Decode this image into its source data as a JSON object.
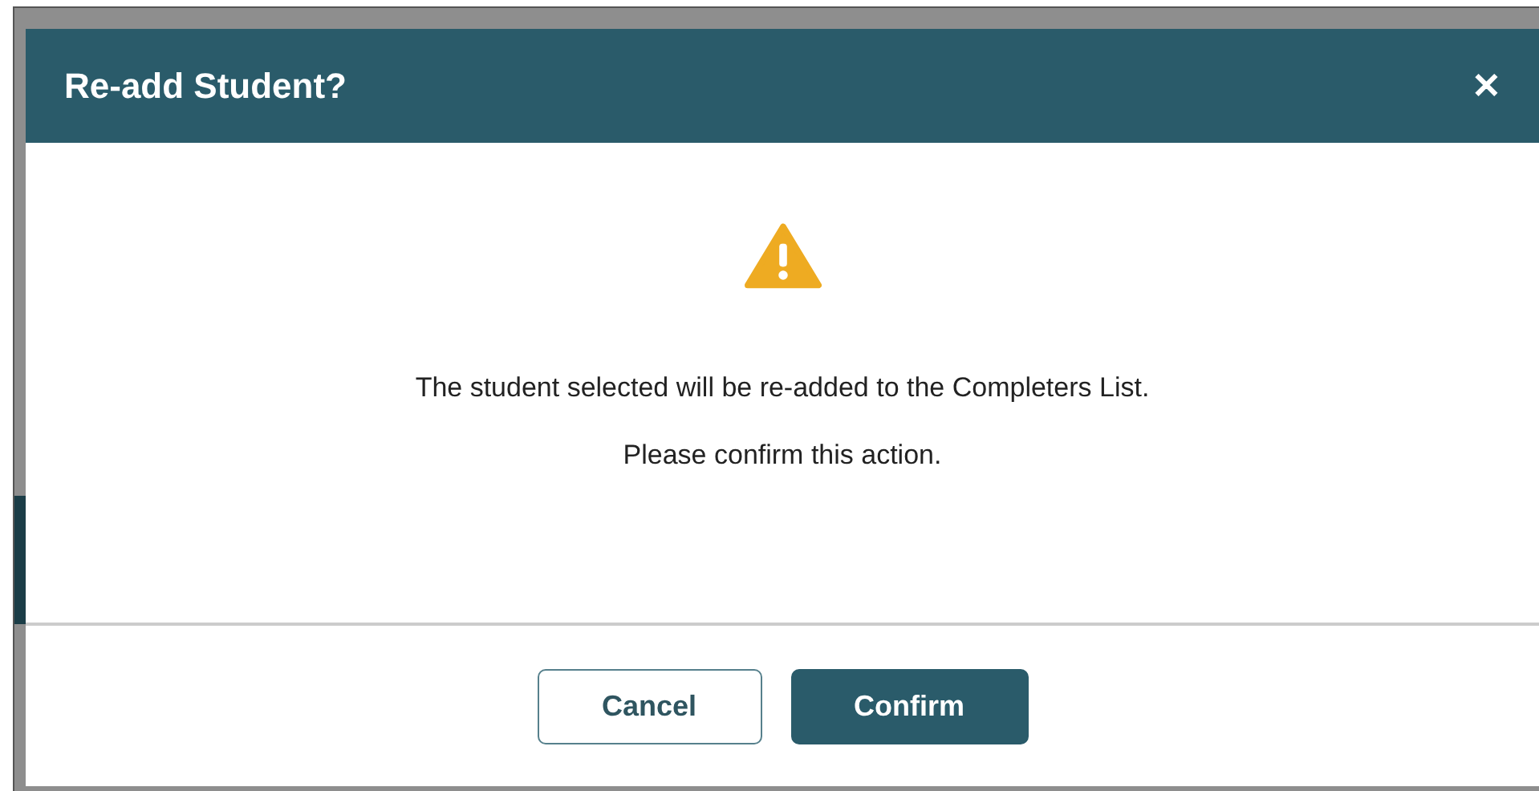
{
  "dialog": {
    "title": "Re-add Student?",
    "close": "✕",
    "messages": [
      "The student selected will be re-added to the Completers List.",
      "Please confirm this action."
    ],
    "buttons": [
      {
        "label": "Cancel",
        "kind": "secondary"
      },
      {
        "label": "Confirm",
        "kind": "primary"
      }
    ]
  }
}
